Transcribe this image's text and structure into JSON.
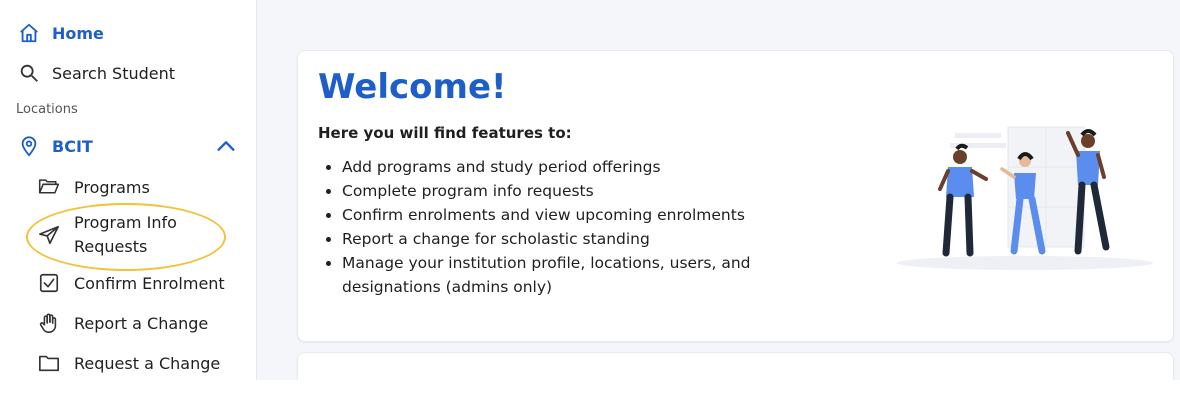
{
  "sidebar": {
    "home": {
      "label": "Home",
      "icon": "home-icon"
    },
    "search": {
      "label": "Search Student",
      "icon": "search-icon"
    },
    "section_label": "Locations",
    "location": {
      "label": "BCIT",
      "icon": "map-pin-icon",
      "expand_icon": "chevron-up-icon"
    },
    "items": [
      {
        "label": "Programs",
        "icon": "folder-open-icon"
      },
      {
        "label": "Program Info",
        "label2": "Requests",
        "icon": "send-icon"
      },
      {
        "label": "Confirm Enrolment",
        "icon": "checkbox-icon"
      },
      {
        "label": "Report a Change",
        "icon": "hand-icon"
      },
      {
        "label": "Request a Change",
        "icon": "folder-icon"
      }
    ]
  },
  "main": {
    "welcome": {
      "title": "Welcome!",
      "subtitle": "Here you will find features to:",
      "features": [
        "Add programs and study period offerings",
        "Complete program info requests",
        "Confirm enrolments and view upcoming enrolments",
        "Report a change for scholastic standing",
        "Manage your institution profile, locations, users, and designations (admins only)"
      ]
    }
  },
  "colors": {
    "accent": "#1e5ec8",
    "highlight": "#f2c23a",
    "background": "#f5f6fa",
    "illustration_blue": "#5b8def"
  }
}
